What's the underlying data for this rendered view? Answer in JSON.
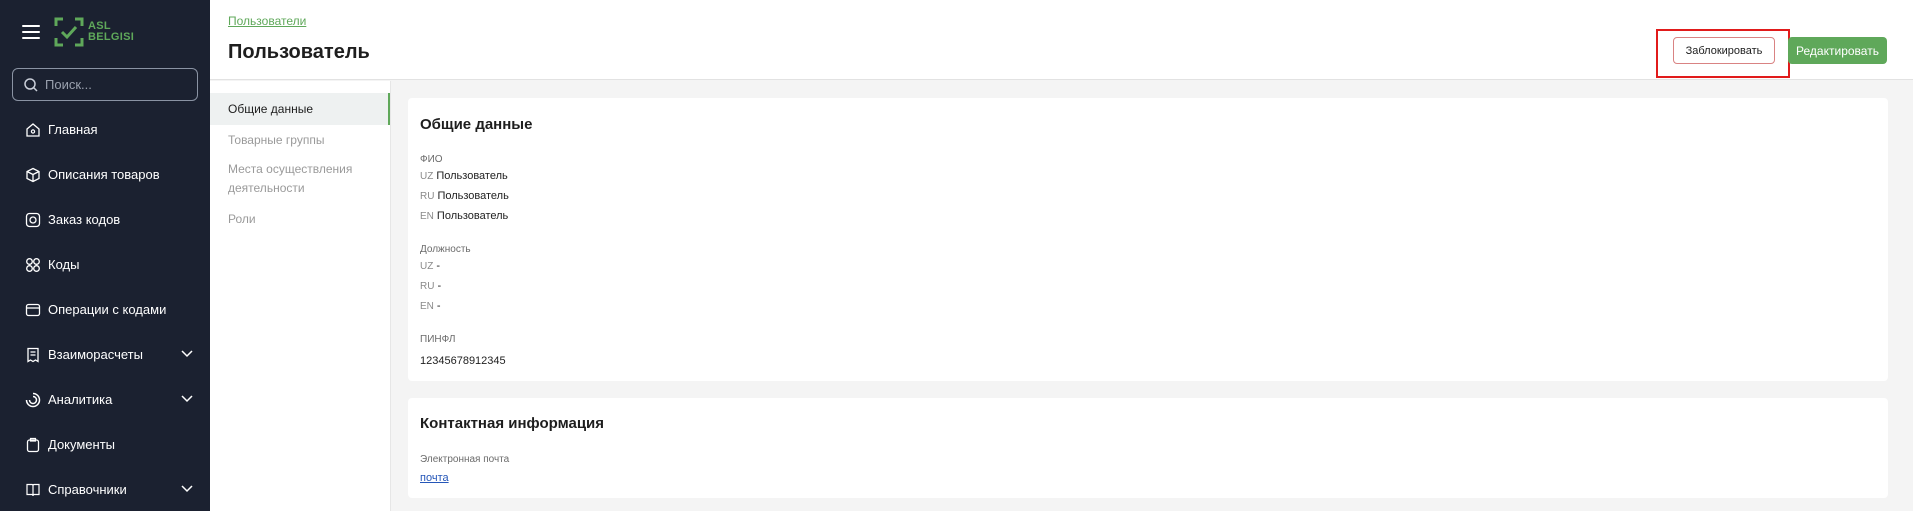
{
  "sidebar": {
    "logo": {
      "line1": "ASL",
      "line2": "BELGISI"
    },
    "search_placeholder": "Поиск...",
    "items": [
      {
        "label": "Главная",
        "icon": "home-icon",
        "expandable": false
      },
      {
        "label": "Описания товаров",
        "icon": "box-icon",
        "expandable": false
      },
      {
        "label": "Заказ кодов",
        "icon": "code-order-icon",
        "expandable": false
      },
      {
        "label": "Коды",
        "icon": "codes-icon",
        "expandable": false
      },
      {
        "label": "Операции с кодами",
        "icon": "operations-icon",
        "expandable": false
      },
      {
        "label": "Взаиморасчеты",
        "icon": "settlements-icon",
        "expandable": true
      },
      {
        "label": "Аналитика",
        "icon": "analytics-icon",
        "expandable": true
      },
      {
        "label": "Документы",
        "icon": "documents-icon",
        "expandable": false
      },
      {
        "label": "Справочники",
        "icon": "book-icon",
        "expandable": true
      }
    ]
  },
  "header": {
    "breadcrumb": "Пользователи",
    "title": "Пользователь",
    "block_label": "Заблокировать",
    "edit_label": "Редактировать"
  },
  "tabs": [
    {
      "label": "Общие данные"
    },
    {
      "label": "Товарные группы"
    },
    {
      "label": "Места осуществления деятельности"
    },
    {
      "label": "Роли"
    }
  ],
  "general": {
    "title": "Общие данные",
    "fio_label": "ФИО",
    "fio": [
      {
        "lang": "UZ",
        "value": "Пользователь"
      },
      {
        "lang": "RU",
        "value": "Пользователь"
      },
      {
        "lang": "EN",
        "value": "Пользователь"
      }
    ],
    "position_label": "Должность",
    "position": [
      {
        "lang": "UZ",
        "value": "-"
      },
      {
        "lang": "RU",
        "value": "-"
      },
      {
        "lang": "EN",
        "value": "-"
      }
    ],
    "pinfl_label": "ПИНФЛ",
    "pinfl": "12345678912345"
  },
  "contact": {
    "title": "Контактная информация",
    "email_label": "Электронная почта",
    "email": "почта"
  },
  "colors": {
    "sidebar_bg": "#1b2130",
    "accent": "#5fa85a",
    "highlight": "#e11b1b"
  }
}
